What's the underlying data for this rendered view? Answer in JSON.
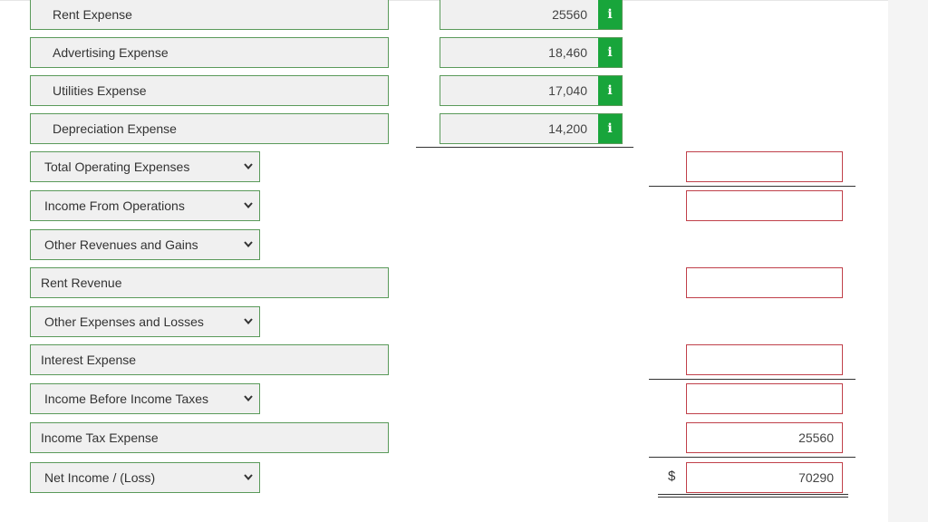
{
  "rows": {
    "rent_expense": {
      "label": "Rent Expense",
      "amount": "25560",
      "info": "i"
    },
    "advertising_expense": {
      "label": "Advertising Expense",
      "amount": "18,460",
      "info": "i"
    },
    "utilities_expense": {
      "label": "Utilities Expense",
      "amount": "17,040",
      "info": "i"
    },
    "depreciation_expense": {
      "label": "Depreciation Expense",
      "amount": "14,200",
      "info": "i"
    },
    "total_operating_expenses": {
      "label": "Total Operating Expenses",
      "total": ""
    },
    "income_from_operations": {
      "label": "Income From Operations",
      "total": ""
    },
    "other_revenues_gains": {
      "label": "Other Revenues and Gains"
    },
    "rent_revenue": {
      "label": "Rent Revenue",
      "total": ""
    },
    "other_expenses_losses": {
      "label": "Other Expenses and Losses"
    },
    "interest_expense": {
      "label": "Interest Expense",
      "total": ""
    },
    "income_before_taxes": {
      "label": "Income Before Income Taxes",
      "total": ""
    },
    "income_tax_expense": {
      "label": "Income Tax Expense",
      "total": "25560"
    },
    "net_income": {
      "label": "Net Income / (Loss)",
      "currency": "$",
      "total": "70290"
    }
  },
  "colors": {
    "field_border": "#5a9a5a",
    "field_bg": "#f0f0f0",
    "info_button": "#18a53b",
    "error_border": "#c0404a"
  },
  "icons": {
    "info": "info-icon",
    "dropdown": "chevron-down-icon"
  }
}
